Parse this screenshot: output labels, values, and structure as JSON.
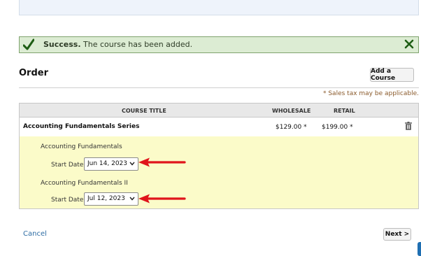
{
  "alert": {
    "status": "Success.",
    "message": " The course has been added.",
    "icons": [
      "check-icon",
      "close-icon"
    ]
  },
  "order": {
    "title": "Order",
    "add_course_label": "Add a Course",
    "tax_note": "* Sales tax may be applicable."
  },
  "table": {
    "columns": [
      "COURSE TITLE",
      "WHOLESALE",
      "RETAIL"
    ],
    "rows": [
      {
        "name": "Accounting Fundamentals Series",
        "wholesale": "$129.00 *",
        "retail": "$199.00 *",
        "delete_icon": "trash-icon",
        "sub_courses": [
          {
            "title": "Accounting Fundamentals",
            "start_label": "Start Date:",
            "start_value": "Jun 14, 2023"
          },
          {
            "title": "Accounting Fundamentals II",
            "start_label": "Start Date:",
            "start_value": "Jul 12, 2023"
          }
        ]
      }
    ]
  },
  "footer": {
    "cancel_label": "Cancel",
    "next_label": "Next >"
  },
  "colors": {
    "success_bg": "#dcecd3",
    "success_border": "#7fa36e",
    "highlight_bg": "#fbfbc9",
    "annotation_arrow": "#e0141b",
    "link": "#2e6da4"
  }
}
